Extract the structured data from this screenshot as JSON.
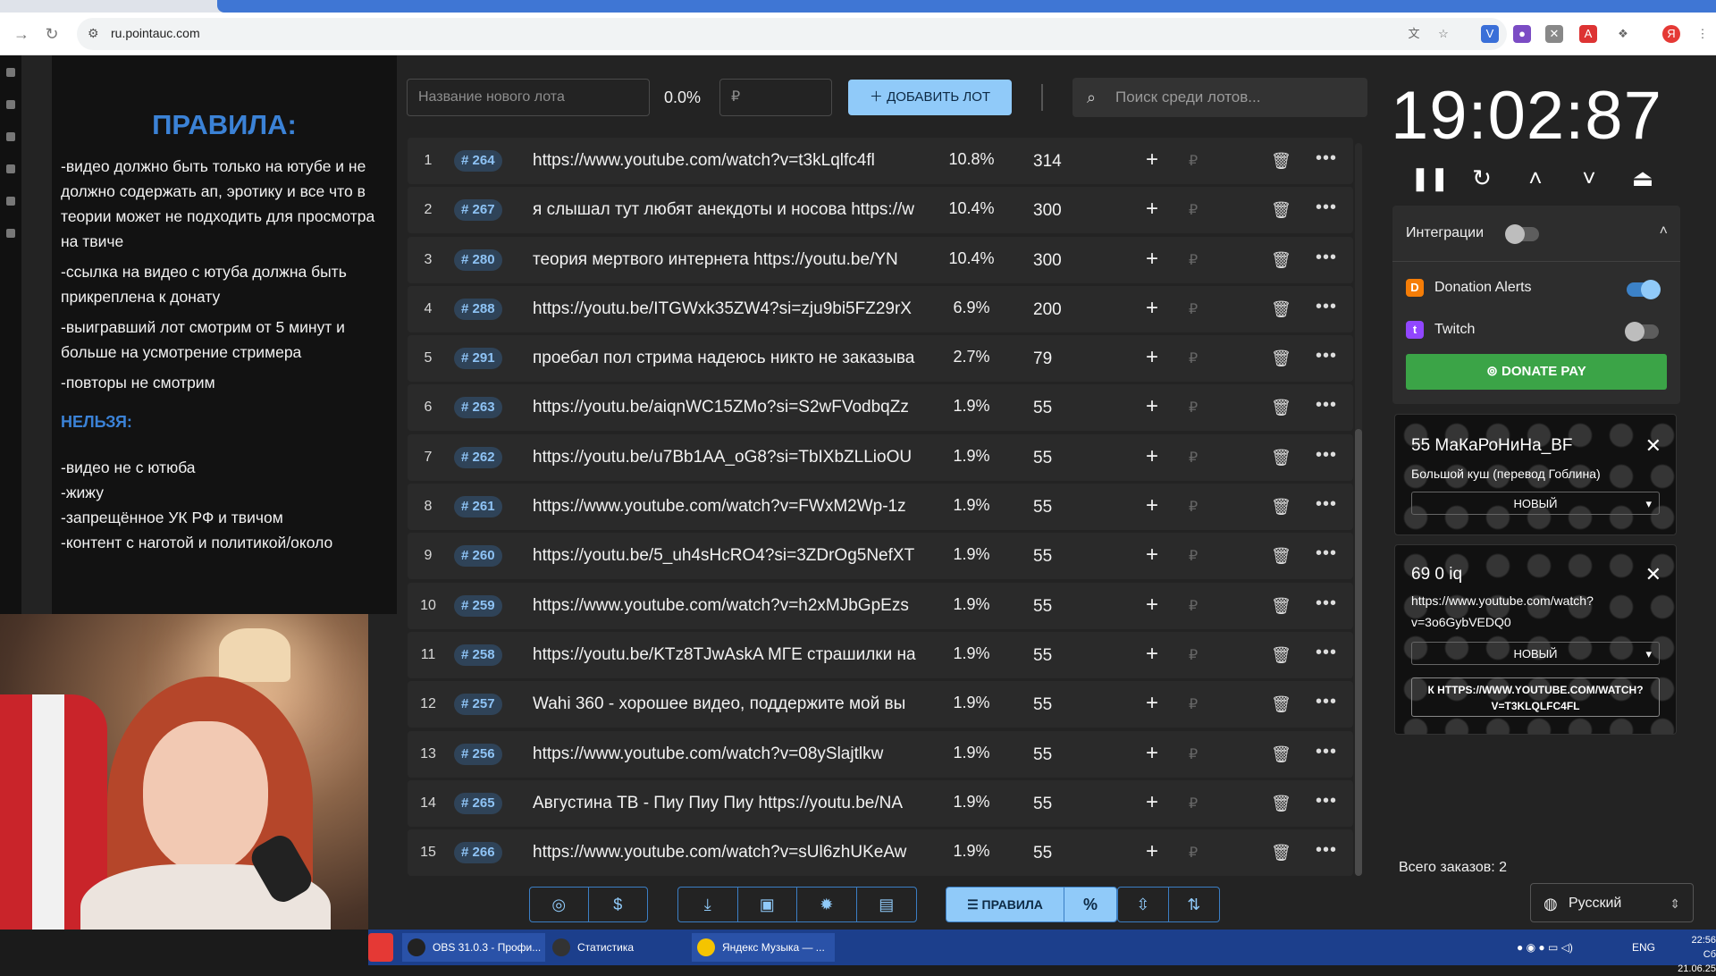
{
  "browser": {
    "url": "ru.pointauc.com"
  },
  "rules": {
    "title": "ПРАВИЛА:",
    "items": [
      "-видео должно быть только на ютубе и не должно содержать ап, эротику и все что в теории может не подходить для просмотра на твиче",
      "-ссылка на видео с ютуба должна быть прикреплена к донату",
      "-выигравший лот смотрим от 5 минут и больше на усмотрение стримера",
      "-повторы не смотрим"
    ],
    "forbidden_title": "НЕЛЬЗЯ:",
    "forbidden": [
      "-видео не с ютюба",
      "-жижу",
      "-запрещённое УК РФ и твичом",
      "-контент с наготой и политикой/около"
    ]
  },
  "add_lot": {
    "name_placeholder": "Название нового лота",
    "percent": "0.0%",
    "amount_placeholder": "₽",
    "add_button": "ДОБАВИТЬ ЛОТ",
    "search_placeholder": "Поиск среди лотов..."
  },
  "lots": [
    {
      "n": "1",
      "id": "# 264",
      "name": "https://www.youtube.com/watch?v=t3kLqlfc4fl",
      "pct": "10.8%",
      "amount": "314"
    },
    {
      "n": "2",
      "id": "# 267",
      "name": "я слышал тут любят анекдоты и носова https://w",
      "pct": "10.4%",
      "amount": "300"
    },
    {
      "n": "3",
      "id": "# 280",
      "name": "теория мертвого интернета https://youtu.be/YN",
      "pct": "10.4%",
      "amount": "300"
    },
    {
      "n": "4",
      "id": "# 288",
      "name": "https://youtu.be/ITGWxk35ZW4?si=zju9bi5FZ29rX",
      "pct": "6.9%",
      "amount": "200"
    },
    {
      "n": "5",
      "id": "# 291",
      "name": "проебал пол стрима надеюсь никто не заказыва",
      "pct": "2.7%",
      "amount": "79"
    },
    {
      "n": "6",
      "id": "# 263",
      "name": "https://youtu.be/aiqnWC15ZMo?si=S2wFVodbqZz",
      "pct": "1.9%",
      "amount": "55"
    },
    {
      "n": "7",
      "id": "# 262",
      "name": "https://youtu.be/u7Bb1AA_oG8?si=TbIXbZLLioOU",
      "pct": "1.9%",
      "amount": "55"
    },
    {
      "n": "8",
      "id": "# 261",
      "name": "https://www.youtube.com/watch?v=FWxM2Wp-1z",
      "pct": "1.9%",
      "amount": "55"
    },
    {
      "n": "9",
      "id": "# 260",
      "name": "https://youtu.be/5_uh4sHcRO4?si=3ZDrOg5NefXT",
      "pct": "1.9%",
      "amount": "55"
    },
    {
      "n": "10",
      "id": "# 259",
      "name": "https://www.youtube.com/watch?v=h2xMJbGpEzs",
      "pct": "1.9%",
      "amount": "55"
    },
    {
      "n": "11",
      "id": "# 258",
      "name": "https://youtu.be/KTz8TJwAskA МГЕ страшилки на",
      "pct": "1.9%",
      "amount": "55"
    },
    {
      "n": "12",
      "id": "# 257",
      "name": "Wahi 360 - хорошее видео, поддержите мой вы",
      "pct": "1.9%",
      "amount": "55"
    },
    {
      "n": "13",
      "id": "# 256",
      "name": "https://www.youtube.com/watch?v=08ySlajtlkw",
      "pct": "1.9%",
      "amount": "55"
    },
    {
      "n": "14",
      "id": "# 265",
      "name": "Августина ТВ - Пиу Пиу Пиу https://youtu.be/NA",
      "pct": "1.9%",
      "amount": "55"
    },
    {
      "n": "15",
      "id": "# 266",
      "name": "https://www.youtube.com/watch?v=sUl6zhUKeAw",
      "pct": "1.9%",
      "amount": "55"
    }
  ],
  "row_labels": {
    "currency": "₽"
  },
  "toolbar": {
    "rules_label": "ПРАВИЛА",
    "percent_label": "%"
  },
  "timer": "19:02:87",
  "integrations": {
    "title": "Интеграции",
    "donation_alerts": "Donation Alerts",
    "twitch": "Twitch",
    "donatepay": "DONATE PAY"
  },
  "donations": [
    {
      "title": "55 МаКаРоНиНа_BF",
      "message": "Большой куш (перевод Гоблина)",
      "status": "НОВЫЙ"
    },
    {
      "title": "69 0 iq",
      "message_line1": "https://www.youtube.com/watch?",
      "message_line2": "v=3o6GybVEDQ0",
      "status": "НОВЫЙ",
      "link_line1": "К HTTPS://WWW.YOUTUBE.COM/WATCH?",
      "link_line2": "V=T3KLQLFC4FL"
    }
  ],
  "orders_total": "Всего заказов: 2",
  "language": "Русский",
  "taskbar": {
    "obs": "OBS 31.0.3 - Профи...",
    "stats": "Статистика",
    "music": "Яндекс Музыка — ...",
    "lang": "ENG",
    "time": "22:56",
    "date": "Сб 21.06.25"
  },
  "colors": {
    "accent": "#90caf9",
    "rules_title": "#3b82d6",
    "donatepay": "#3ba447"
  }
}
